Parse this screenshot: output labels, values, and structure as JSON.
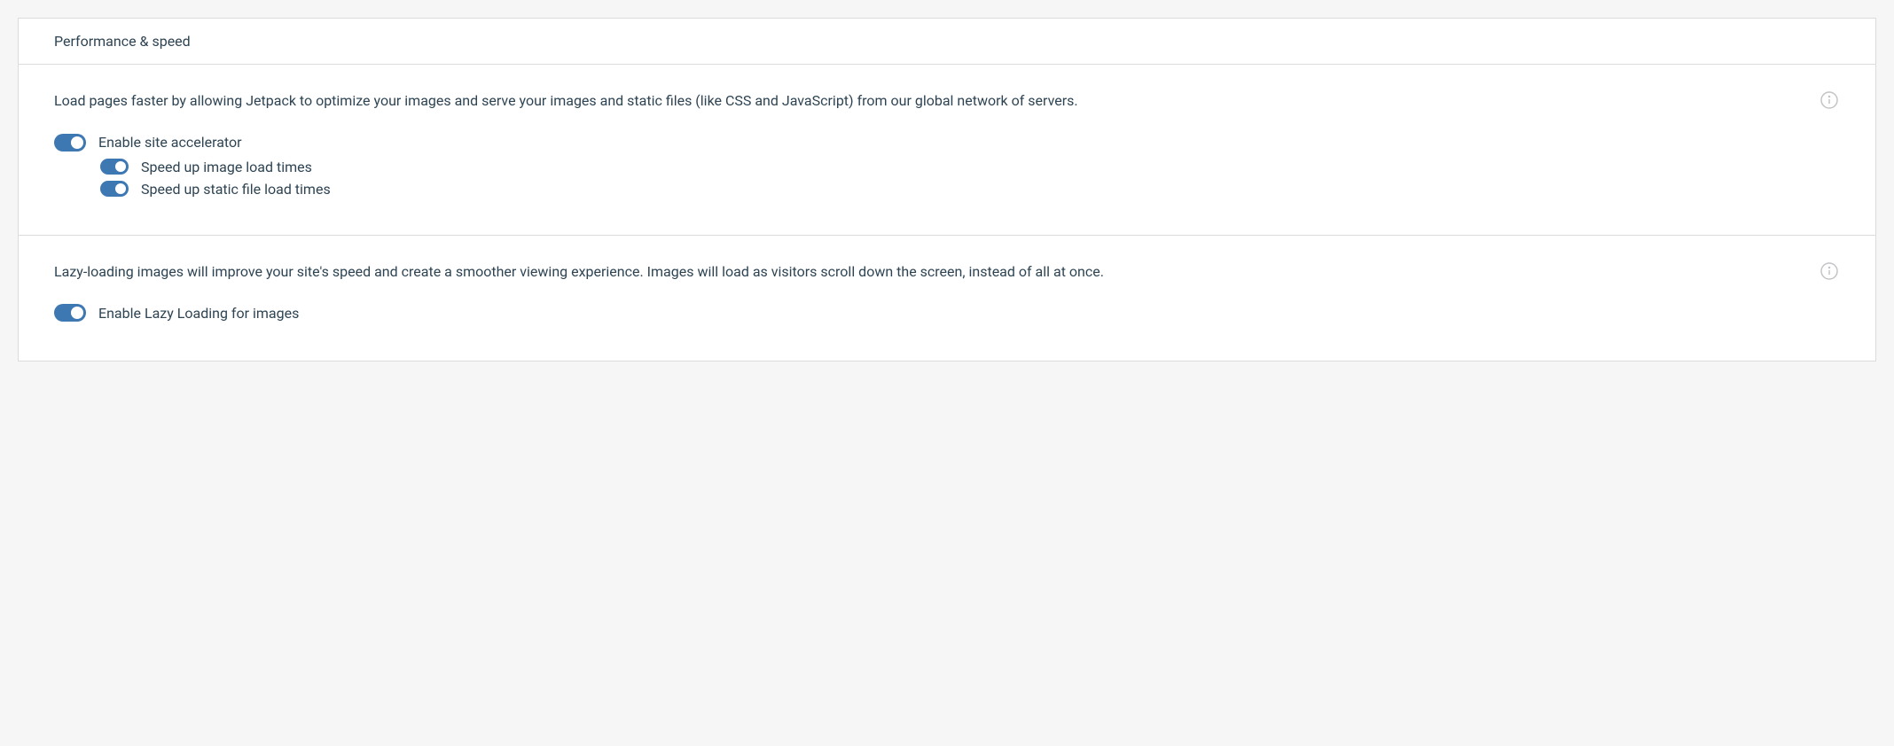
{
  "card": {
    "title": "Performance & speed"
  },
  "accelerator": {
    "description": "Load pages faster by allowing Jetpack to optimize your images and serve your images and static files (like CSS and JavaScript) from our global network of servers.",
    "toggle_label": "Enable site accelerator",
    "sub": {
      "images": "Speed up image load times",
      "static": "Speed up static file load times"
    }
  },
  "lazy": {
    "description": "Lazy-loading images will improve your site's speed and create a smoother viewing experience. Images will load as visitors scroll down the screen, instead of all at once.",
    "toggle_label": "Enable Lazy Loading for images"
  }
}
